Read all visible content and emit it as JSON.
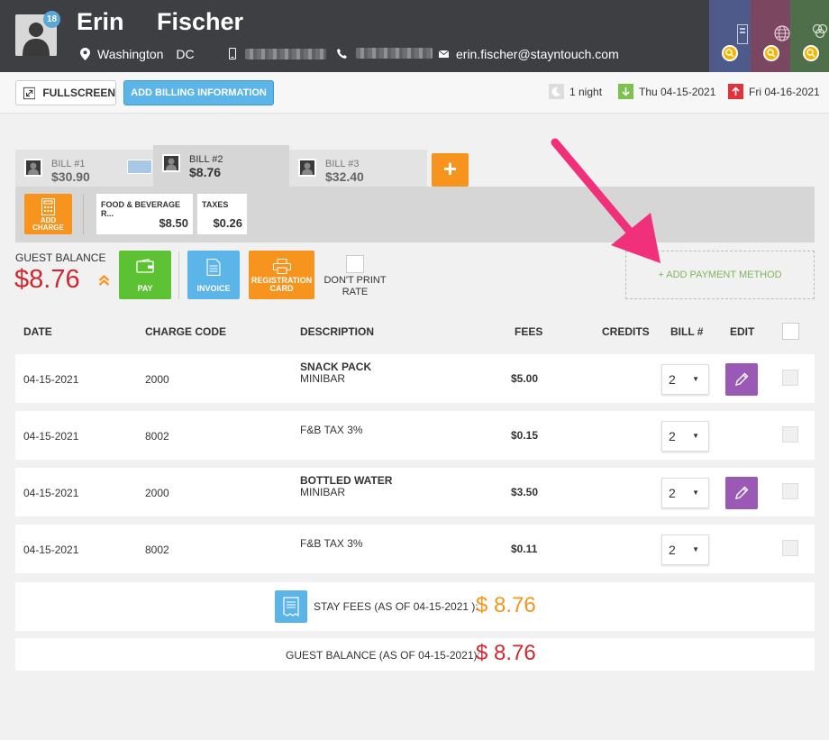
{
  "guest": {
    "first_name": "Erin",
    "last_name": "Fischer",
    "notification_count": "18",
    "city": "Washington",
    "state": "DC",
    "email": "erin.fischer@stayntouch.com"
  },
  "toolbar": {
    "fullscreen_label": "FULLSCREEN",
    "add_billing_label": "ADD BILLING INFORMATION",
    "nights": "1 night",
    "arrival": "Thu 04-15-2021",
    "departure": "Fri 04-16-2021"
  },
  "bills": [
    {
      "label": "BILL #1",
      "amount": "$30.90"
    },
    {
      "label": "BILL #2",
      "amount": "$8.76"
    },
    {
      "label": "BILL #3",
      "amount": "$32.40"
    }
  ],
  "add_bill_label": "+",
  "charges_strip": {
    "add_charge_label": "ADD CHARGE",
    "cards": [
      {
        "title": "FOOD & BEVERAGE R...",
        "amount": "$8.50"
      },
      {
        "title": "TAXES",
        "amount": "$0.26"
      }
    ]
  },
  "balance": {
    "label": "GUEST BALANCE",
    "value": "$8.76"
  },
  "actions": {
    "pay": "PAY",
    "invoice": "INVOICE",
    "registration": "REGISTRATION CARD",
    "dont_print": "DON'T PRINT RATE",
    "add_payment": "+ ADD PAYMENT METHOD"
  },
  "table": {
    "headers": {
      "date": "DATE",
      "charge_code": "CHARGE CODE",
      "description": "DESCRIPTION",
      "fees": "FEES",
      "credits": "CREDITS",
      "bill": "BILL #",
      "edit": "EDIT"
    },
    "rows": [
      {
        "date": "04-15-2021",
        "code": "2000",
        "desc_title": "SNACK PACK",
        "desc_sub": "MINIBAR",
        "fee": "$5.00",
        "bill": "2"
      },
      {
        "date": "04-15-2021",
        "code": "8002",
        "desc_title": "",
        "desc_sub": "F&B TAX 3%",
        "fee": "$0.15",
        "bill": "2"
      },
      {
        "date": "04-15-2021",
        "code": "2000",
        "desc_title": "BOTTLED WATER",
        "desc_sub": "MINIBAR",
        "fee": "$3.50",
        "bill": "2"
      },
      {
        "date": "04-15-2021",
        "code": "8002",
        "desc_title": "",
        "desc_sub": "F&B TAX 3%",
        "fee": "$0.11",
        "bill": "2"
      }
    ]
  },
  "totals": {
    "stay_fees_label": "STAY FEES (AS OF 04-15-2021 ):",
    "stay_fees_value": "$ 8.76",
    "guest_balance_label": "GUEST BALANCE (AS OF 04-15-2021):",
    "guest_balance_value": "$ 8.76"
  },
  "colors": {
    "header_bg": "#3d3f42",
    "orange": "#f7941d",
    "blue": "#5bb5e8",
    "green": "#5dc233",
    "purple": "#9b59b6",
    "red": "#d0282f",
    "annotation_pink": "#f0307a"
  }
}
